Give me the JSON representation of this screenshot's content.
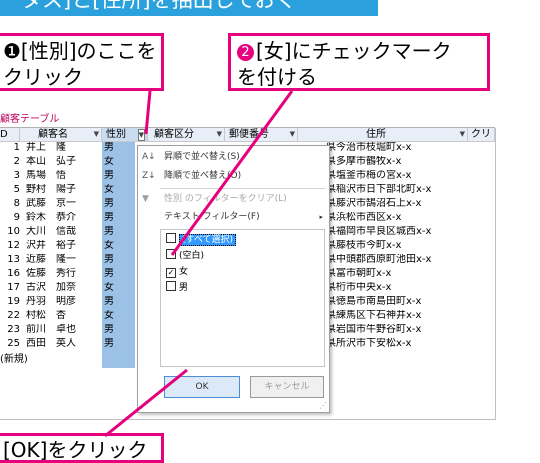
{
  "banner": {
    "text": "ータス]と[住所]を抽出しておく"
  },
  "callout1": {
    "text": "❶[性別]のここを\nクリック"
  },
  "callout2": {
    "num": "2",
    "line1": "[女]にチェックマーク",
    "line2": "を付ける"
  },
  "callout3": {
    "text": "[OK]をクリック"
  },
  "colors": {
    "accent": "#e6007e",
    "banner": "#2aa1dc",
    "highlight": "#9bc2e6"
  },
  "table": {
    "tab_label": "顧客テーブル",
    "headers": [
      "D",
      "顧客名",
      "性別",
      "顧客区分",
      "郵便番号",
      "住所",
      "クリ"
    ],
    "rows": [
      {
        "id": "1",
        "name": "井上　隆",
        "gender": "男",
        "address": "県今治市枝堀町x-x"
      },
      {
        "id": "2",
        "name": "本山　弘子",
        "gender": "女",
        "address": "県多摩市鶴牧x-x"
      },
      {
        "id": "3",
        "name": "馬場　悟",
        "gender": "男",
        "address": "県塩釜市梅の宮x-x"
      },
      {
        "id": "5",
        "name": "野村　陽子",
        "gender": "女",
        "address": "県稲沢市日下部北町x-x"
      },
      {
        "id": "8",
        "name": "武藤　京一",
        "gender": "男",
        "address": "県藤沢市鵠沼石上x-x"
      },
      {
        "id": "9",
        "name": "鈴木　恭介",
        "gender": "男",
        "address": "県浜松市西区x-x"
      },
      {
        "id": "10",
        "name": "大川　信哉",
        "gender": "男",
        "address": "県福岡市早良区城西x-x"
      },
      {
        "id": "12",
        "name": "沢井　裕子",
        "gender": "女",
        "address": "県藤枝市今町x-x"
      },
      {
        "id": "13",
        "name": "近藤　隆一",
        "gender": "男",
        "address": "県中頭郡西原町池田x-x"
      },
      {
        "id": "16",
        "name": "佐藤　秀行",
        "gender": "男",
        "address": "県富市朝町x-x"
      },
      {
        "id": "17",
        "name": "古沢　加奈",
        "gender": "女",
        "address": "県桁市中央x-x"
      },
      {
        "id": "19",
        "name": "丹羽　明彦",
        "gender": "男",
        "address": "県徳島市南島田町x-x"
      },
      {
        "id": "22",
        "name": "村松　杏",
        "gender": "女",
        "address": "県練馬区下石神井x-x"
      },
      {
        "id": "23",
        "name": "前川　卓也",
        "gender": "男",
        "address": "県岩国市牛野谷町x-x"
      },
      {
        "id": "25",
        "name": "西田　英人",
        "gender": "男",
        "address": "県所沢市下安松x-x"
      }
    ],
    "new_row": "(新規)"
  },
  "menu": {
    "sort_asc": "昇順で並べ替え(S)",
    "sort_desc": "降順で並べ替え(O)",
    "clear_filter": "性別 のフィルターをクリア(L)",
    "text_filter": "テキスト フィルター(F)",
    "options": [
      {
        "label": "(すべて選択)",
        "checked": false,
        "mark": ""
      },
      {
        "label": "(空白)",
        "checked": false,
        "mark": ""
      },
      {
        "label": "女",
        "checked": true,
        "mark": "✓"
      },
      {
        "label": "男",
        "checked": false,
        "mark": ""
      }
    ],
    "ok": "OK",
    "cancel": "キャンセル"
  }
}
